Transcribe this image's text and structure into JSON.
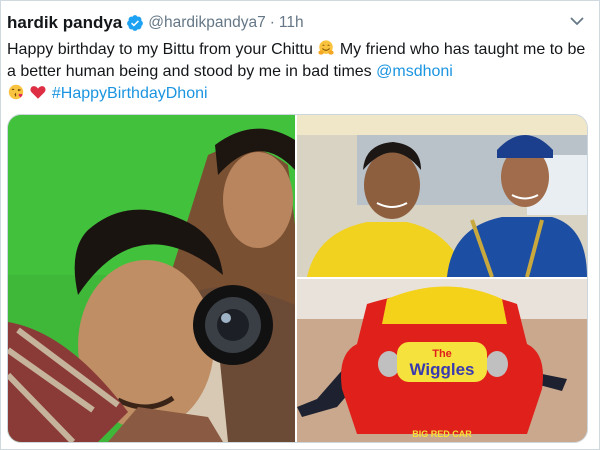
{
  "tweet": {
    "author_name": "hardik pandya",
    "handle": "@hardikpandya7",
    "separator": "·",
    "timestamp": "11h",
    "text_part1": "Happy birthday to my Bittu from your Chittu",
    "text_part2": "My friend who has taught me to be a better human being and stood by me in bad times",
    "mention": "@msdhoni",
    "hashtag": "#HappyBirthdayDhoni",
    "emojis": [
      "hugging-face",
      "kissing-face",
      "red-heart"
    ]
  },
  "media": {
    "photos": [
      {
        "description_icon": "photo-selfie-green-screen"
      },
      {
        "description_icon": "photo-dhoni-and-pandya-at-airport"
      },
      {
        "description_icon": "photo-wiggles-big-red-car",
        "car_logo_text": "The Wiggles",
        "car_logo_line1": "The",
        "car_logo_line2": "Wiggles",
        "car_plate_text": "BIG RED CAR"
      }
    ]
  },
  "colors": {
    "link": "#1b95e0",
    "secondary_text": "#657786",
    "verified_badge": "#1da1f2"
  }
}
